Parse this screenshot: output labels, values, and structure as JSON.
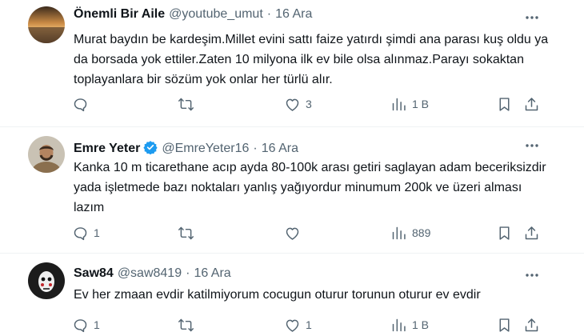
{
  "tweets": [
    {
      "name": "Önemli Bir Aile",
      "handle": "@youtube_umut",
      "sep": "·",
      "date": "16 Ara",
      "verified": false,
      "text": "Murat baydın be kardeşim.Millet evini sattı faize yatırdı şimdi ana parası kuş oldu ya da borsada yok ettiler.Zaten 10 milyona ilk ev bile olsa alınmaz.Parayı sokaktan toplayanlara bir sözüm yok onlar her türlü alır.",
      "replies": "",
      "retweets": "",
      "likes": "3",
      "views": "1 B"
    },
    {
      "name": "Emre Yeter",
      "handle": "@EmreYeter16",
      "sep": "·",
      "date": "16 Ara",
      "verified": true,
      "text": "Kanka 10 m ticarethane acıp ayda 80-100k arası getiri saglayan adam beceriksizdir yada işletmede bazı noktaları yanlış yağıyordur minumum 200k ve üzeri alması lazım",
      "replies": "1",
      "retweets": "",
      "likes": "",
      "views": "889"
    },
    {
      "name": "Saw84",
      "handle": "@saw8419",
      "sep": "·",
      "date": "16 Ara",
      "verified": false,
      "text": "Ev her zmaan evdir katilmiyorum cocugun oturur torunun oturur ev evdir",
      "replies": "1",
      "retweets": "",
      "likes": "1",
      "views": "1 B"
    }
  ],
  "icons": {
    "reply": "reply-icon",
    "retweet": "retweet-icon",
    "like": "heart-icon",
    "views": "views-icon",
    "bookmark": "bookmark-icon",
    "share": "share-icon",
    "more": "more-icon",
    "verified": "verified-badge-icon"
  },
  "colors": {
    "text": "#0f1419",
    "muted": "#536471",
    "verified": "#1d9bf0",
    "divider": "#eff3f4"
  }
}
